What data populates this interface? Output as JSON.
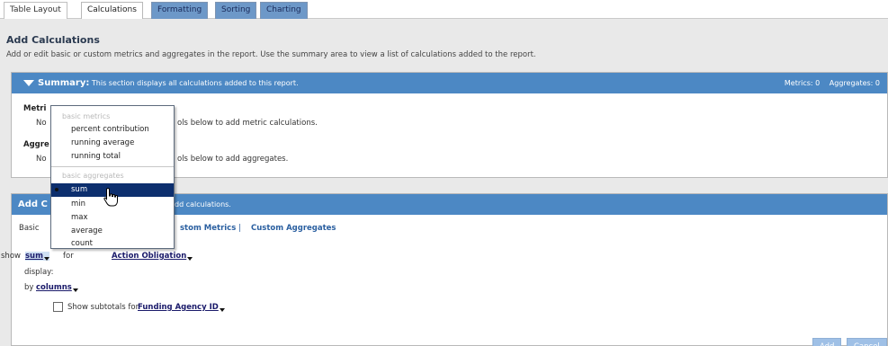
{
  "tabs": [
    {
      "label": "Table Layout",
      "state": "plain"
    },
    {
      "label": "Calculations",
      "state": "active"
    },
    {
      "label": "Formatting",
      "state": "inactive"
    },
    {
      "label": "Sorting",
      "state": "inactive"
    },
    {
      "label": "Charting",
      "state": "inactive"
    }
  ],
  "header": {
    "title": "Add Calculations",
    "description": "Add or edit basic or custom metrics and aggregates in the report. Use the summary area to view a list of calculations added to the report."
  },
  "summary": {
    "title": "Summary:",
    "subtitle": "This section displays all calculations added to this report.",
    "metrics_count": "Metrics: 0",
    "aggregates_count": "Aggregates: 0",
    "metrics_label": "Metri",
    "metrics_none": "No",
    "metrics_hint": "ols below to add metric calculations.",
    "aggregates_label": "Aggre",
    "aggregates_none": "No",
    "aggregates_hint": "ols below to add aggregates."
  },
  "add_calc": {
    "title": "Add C",
    "subtitle": "dd calculations.",
    "basic_label": "Basic",
    "link_custom_metrics": "stom Metrics",
    "link_separator": "|",
    "link_custom_aggregates": "Custom Aggregates",
    "show_label": "show",
    "show_value": "sum",
    "for_label": "for",
    "field_value": "Action Obligation",
    "display_label": "display:",
    "by_label": "by",
    "by_value": "columns",
    "subtotals_label": "Show subtotals for",
    "subtotals_value": "Funding Agency ID",
    "add_button": "Add",
    "cancel_button": "Cancel"
  },
  "menu": {
    "group_metrics": "basic metrics",
    "metrics": [
      "percent contribution",
      "running average",
      "running total"
    ],
    "group_aggregates": "basic aggregates",
    "aggregates": [
      "sum",
      "min",
      "max",
      "average",
      "count"
    ],
    "selected": "sum"
  },
  "colors": {
    "panel_header": "#4c88c4",
    "tab_inactive": "#6d98c8",
    "menu_selected": "#0d2f6e",
    "link": "#2a5fa0"
  }
}
